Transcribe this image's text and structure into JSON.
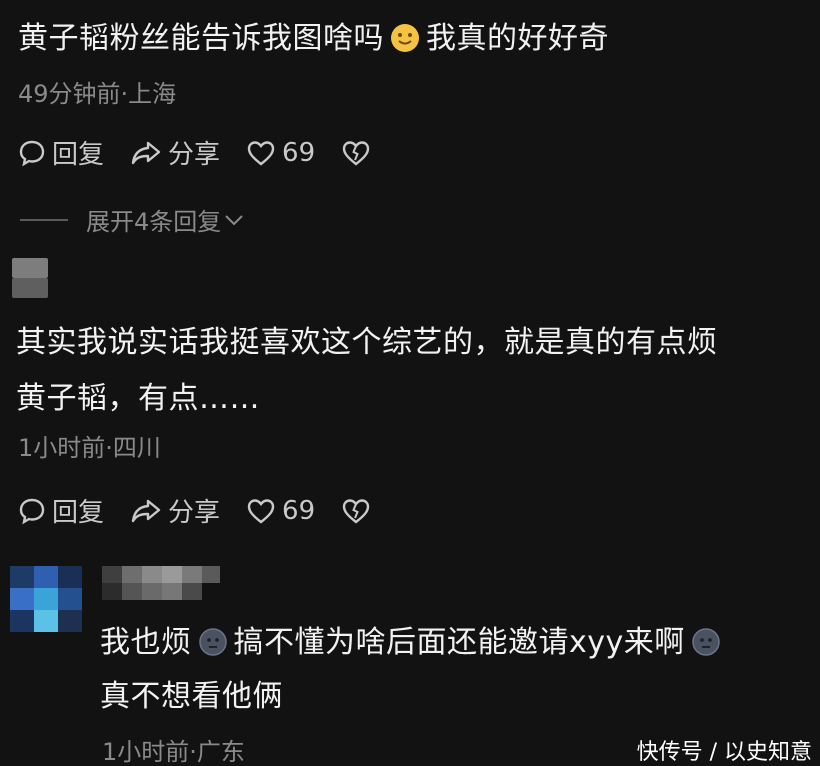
{
  "comments": [
    {
      "text_part1": "黄子韬粉丝能告诉我图啥吗",
      "emoji_1": "smile-emoji",
      "text_part2": "我真的好好奇",
      "meta": "49分钟前·上海",
      "actions": {
        "reply": "回复",
        "share": "分享",
        "likes": "69"
      },
      "expand_label": "展开4条回复"
    },
    {
      "text_line1": "其实我说实话我挺喜欢这个综艺的，就是真的有点烦",
      "text_line2": "黄子韬，有点……",
      "meta": "1小时前·四川",
      "actions": {
        "reply": "回复",
        "share": "分享",
        "likes": "69"
      }
    },
    {
      "text_part1": "我也烦",
      "emoji_1": "annoyed-emoji",
      "text_part2": "搞不懂为啥后面还能邀请xyy来啊",
      "emoji_2": "annoyed-emoji",
      "text_line2": "真不想看他俩",
      "meta": "1小时前·广东"
    }
  ],
  "watermark": "快传号 / 以史知意",
  "colors": {
    "background": "#121213",
    "text": "#f2f2f2",
    "meta": "#8a8a8a",
    "action": "#c9c9c9"
  }
}
